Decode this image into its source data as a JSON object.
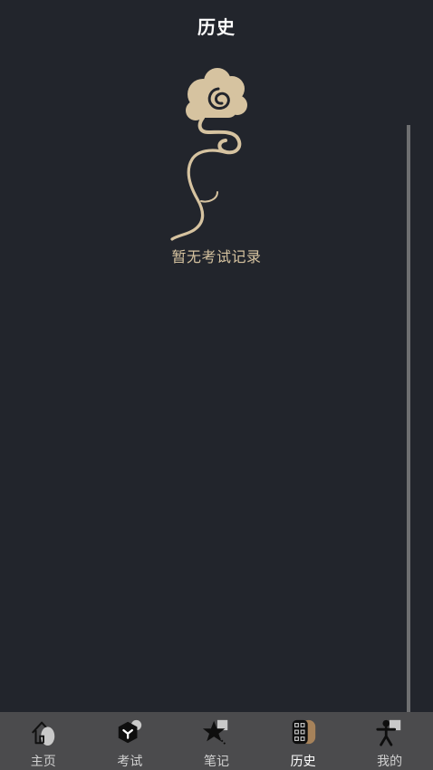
{
  "header": {
    "title": "历史"
  },
  "empty_state": {
    "message": "暂无考试记录",
    "illustration_icon": "auspicious-cloud-icon",
    "accent_color": "#d6c3a0"
  },
  "tabbar": {
    "active_index": 3,
    "items": [
      {
        "label": "主页",
        "icon": "home-icon"
      },
      {
        "label": "考试",
        "icon": "exam-icon"
      },
      {
        "label": "笔记",
        "icon": "notes-icon"
      },
      {
        "label": "历史",
        "icon": "history-icon"
      },
      {
        "label": "我的",
        "icon": "profile-icon"
      }
    ]
  },
  "colors": {
    "background": "#22252c",
    "tabbar_background": "#4b4b4d",
    "scrollbar": "#6e6f71"
  }
}
